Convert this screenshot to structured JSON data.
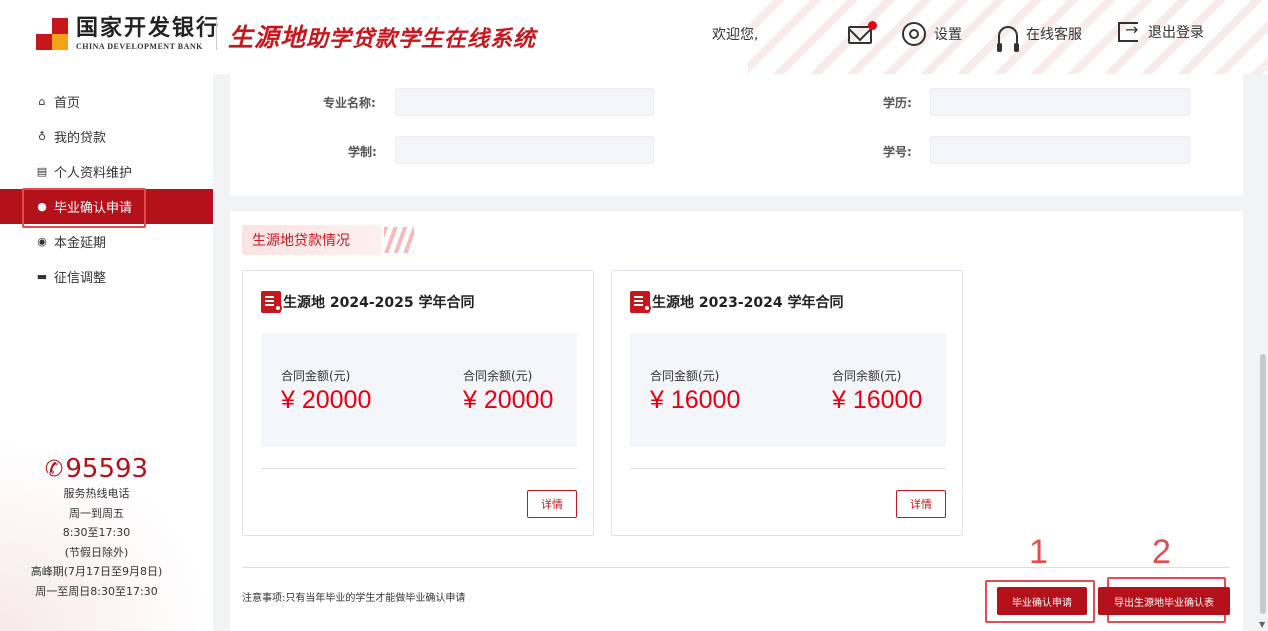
{
  "header": {
    "logo_cn": "国家开发银行",
    "logo_en": "CHINA DEVELOPMENT BANK",
    "system_title_a": "生源地",
    "system_title_b": "助学贷款",
    "system_title_c": "学生在线系统",
    "welcome": "欢迎您,",
    "settings": "设置",
    "service": "在线客服",
    "logout": "退出登录"
  },
  "sidebar": {
    "items": [
      {
        "icon": "home-icon",
        "glyph": "⌂",
        "label": "首页"
      },
      {
        "icon": "loan-icon",
        "glyph": "♁",
        "label": "我的贷款"
      },
      {
        "icon": "id-card-icon",
        "glyph": "▤",
        "label": "个人资料维护"
      },
      {
        "icon": "user-icon",
        "glyph": "●",
        "label": "毕业确认申请"
      },
      {
        "icon": "clock-icon",
        "glyph": "◉",
        "label": "本金延期"
      },
      {
        "icon": "card-icon",
        "glyph": "▬",
        "label": "征信调整"
      }
    ],
    "active_index": 3,
    "hotline": {
      "number": "95593",
      "lines": [
        "服务热线电话",
        "周一到周五",
        "8:30至17:30",
        "(节假日除外)",
        "高峰期(7月17日至9月8日)",
        "周一至周日8:30至17:30"
      ]
    }
  },
  "profile": {
    "major_label": "专业名称:",
    "education_label": "学历:",
    "duration_label": "学制:",
    "student_no_label": "学号:"
  },
  "loans": {
    "section_title": "生源地贷款情况",
    "cards": [
      {
        "title": "生源地 2024-2025 学年合同",
        "amount_label": "合同金额(元)",
        "amount": "¥ 20000",
        "balance_label": "合同余额(元)",
        "balance": "¥ 20000",
        "detail": "详情"
      },
      {
        "title": "生源地 2023-2024 学年合同",
        "amount_label": "合同金额(元)",
        "amount": "¥ 16000",
        "balance_label": "合同余额(元)",
        "balance": "¥ 16000",
        "detail": "详情"
      }
    ]
  },
  "footer": {
    "notice": "注意事项:只有当年毕业的学生才能做毕业确认申请",
    "apply_button": "毕业确认申请",
    "export_button": "导出生源地毕业确认表",
    "annotation_1": "1",
    "annotation_2": "2"
  },
  "colors": {
    "brand_red": "#b4111a",
    "amount_red": "#e60012"
  }
}
